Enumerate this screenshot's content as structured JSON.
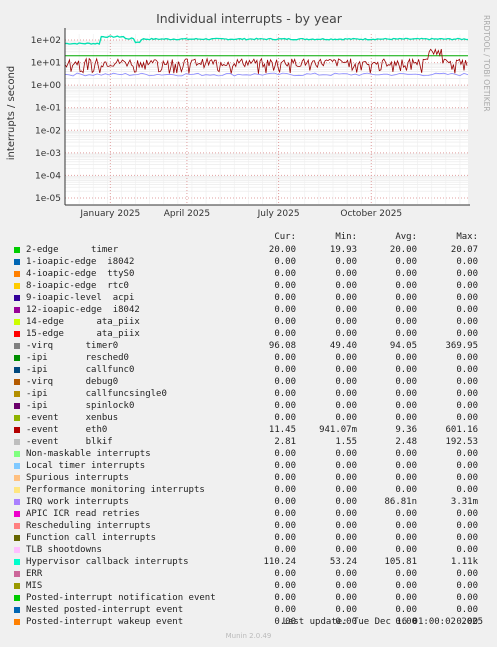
{
  "chart_data": {
    "type": "line",
    "title": "Individual interrupts - by year",
    "ylabel": "interrupts / second",
    "yscale": "log",
    "ylim": [
      1e-05,
      100
    ],
    "y_ticks": [
      "1e+02",
      "1e+01",
      "1e+00",
      "1e-01",
      "1e-02",
      "1e-03",
      "1e-04",
      "1e-05"
    ],
    "x_ticks": [
      "January 2025",
      "April 2025",
      "July 2025",
      "October 2025"
    ],
    "side_label": "RRDTOOL / TOBI OETIKER",
    "grid": true,
    "series_visible": [
      {
        "name": "Hypervisor callback interrupts",
        "color": "#00e0b0",
        "approx": "~70 until Dec 2024, ~110 after"
      },
      {
        "name": "-virq timer0",
        "color": "#990000",
        "approx": "noisy ~5-15 with spikes"
      },
      {
        "name": "2-edge timer",
        "color": "#00aa00",
        "approx": "constant ~20"
      },
      {
        "name": "-event eth0",
        "color": "#8888ff",
        "approx": "~3"
      }
    ]
  },
  "legend_headers": {
    "cur": "Cur:",
    "min": "Min:",
    "avg": "Avg:",
    "max": "Max:"
  },
  "legend": [
    {
      "label": "2-edge      timer",
      "color": "#00cc00",
      "cur": "20.00",
      "min": "19.93",
      "avg": "20.00",
      "max": "20.07"
    },
    {
      "label": "1-ioapic-edge  i8042",
      "color": "#0066b3",
      "cur": "0.00",
      "min": "0.00",
      "avg": "0.00",
      "max": "0.00"
    },
    {
      "label": "4-ioapic-edge  ttyS0",
      "color": "#ff8000",
      "cur": "0.00",
      "min": "0.00",
      "avg": "0.00",
      "max": "0.00"
    },
    {
      "label": "8-ioapic-edge  rtc0",
      "color": "#ffcc00",
      "cur": "0.00",
      "min": "0.00",
      "avg": "0.00",
      "max": "0.00"
    },
    {
      "label": "9-ioapic-level  acpi",
      "color": "#330099",
      "cur": "0.00",
      "min": "0.00",
      "avg": "0.00",
      "max": "0.00"
    },
    {
      "label": "12-ioapic-edge  i8042",
      "color": "#990099",
      "cur": "0.00",
      "min": "0.00",
      "avg": "0.00",
      "max": "0.00"
    },
    {
      "label": "14-edge      ata_piix",
      "color": "#ccff00",
      "cur": "0.00",
      "min": "0.00",
      "avg": "0.00",
      "max": "0.00"
    },
    {
      "label": "15-edge      ata_piix",
      "color": "#ff0000",
      "cur": "0.00",
      "min": "0.00",
      "avg": "0.00",
      "max": "0.00"
    },
    {
      "label": "-virq      timer0",
      "color": "#808080",
      "cur": "96.08",
      "min": "49.40",
      "avg": "94.05",
      "max": "369.95"
    },
    {
      "label": "-ipi       resched0",
      "color": "#008f00",
      "cur": "0.00",
      "min": "0.00",
      "avg": "0.00",
      "max": "0.00"
    },
    {
      "label": "-ipi       callfunc0",
      "color": "#00487d",
      "cur": "0.00",
      "min": "0.00",
      "avg": "0.00",
      "max": "0.00"
    },
    {
      "label": "-virq      debug0",
      "color": "#b35a00",
      "cur": "0.00",
      "min": "0.00",
      "avg": "0.00",
      "max": "0.00"
    },
    {
      "label": "-ipi       callfuncsingle0",
      "color": "#b38f00",
      "cur": "0.00",
      "min": "0.00",
      "avg": "0.00",
      "max": "0.00"
    },
    {
      "label": "-ipi       spinlock0",
      "color": "#6b006b",
      "cur": "0.00",
      "min": "0.00",
      "avg": "0.00",
      "max": "0.00"
    },
    {
      "label": "-event     xenbus",
      "color": "#8fb300",
      "cur": "0.00",
      "min": "0.00",
      "avg": "0.00",
      "max": "0.00"
    },
    {
      "label": "-event     eth0",
      "color": "#b30000",
      "cur": "11.45",
      "min": "941.07m",
      "avg": "9.36",
      "max": "601.16"
    },
    {
      "label": "-event     blkif",
      "color": "#bebebe",
      "cur": "2.81",
      "min": "1.55",
      "avg": "2.48",
      "max": "192.53"
    },
    {
      "label": "Non-maskable interrupts",
      "color": "#80ff80",
      "cur": "0.00",
      "min": "0.00",
      "avg": "0.00",
      "max": "0.00"
    },
    {
      "label": "Local timer interrupts",
      "color": "#80c9ff",
      "cur": "0.00",
      "min": "0.00",
      "avg": "0.00",
      "max": "0.00"
    },
    {
      "label": "Spurious interrupts",
      "color": "#ffc080",
      "cur": "0.00",
      "min": "0.00",
      "avg": "0.00",
      "max": "0.00"
    },
    {
      "label": "Performance monitoring interrupts",
      "color": "#ffe680",
      "cur": "0.00",
      "min": "0.00",
      "avg": "0.00",
      "max": "0.00"
    },
    {
      "label": "IRQ work interrupts",
      "color": "#aa80ff",
      "cur": "0.00",
      "min": "0.00",
      "avg": "86.81n",
      "max": "3.31m"
    },
    {
      "label": "APIC ICR read retries",
      "color": "#ee00cc",
      "cur": "0.00",
      "min": "0.00",
      "avg": "0.00",
      "max": "0.00"
    },
    {
      "label": "Rescheduling interrupts",
      "color": "#ff8080",
      "cur": "0.00",
      "min": "0.00",
      "avg": "0.00",
      "max": "0.00"
    },
    {
      "label": "Function call interrupts",
      "color": "#666600",
      "cur": "0.00",
      "min": "0.00",
      "avg": "0.00",
      "max": "0.00"
    },
    {
      "label": "TLB shootdowns",
      "color": "#ffbfff",
      "cur": "0.00",
      "min": "0.00",
      "avg": "0.00",
      "max": "0.00"
    },
    {
      "label": "Hypervisor callback interrupts",
      "color": "#00ffcc",
      "cur": "110.24",
      "min": "53.24",
      "avg": "105.81",
      "max": "1.11k"
    },
    {
      "label": "ERR",
      "color": "#cc6699",
      "cur": "0.00",
      "min": "0.00",
      "avg": "0.00",
      "max": "0.00"
    },
    {
      "label": "MIS",
      "color": "#999900",
      "cur": "0.00",
      "min": "0.00",
      "avg": "0.00",
      "max": "0.00"
    },
    {
      "label": "Posted-interrupt notification event",
      "color": "#00cc00",
      "cur": "0.00",
      "min": "0.00",
      "avg": "0.00",
      "max": "0.00"
    },
    {
      "label": "Nested posted-interrupt event",
      "color": "#0066b3",
      "cur": "0.00",
      "min": "0.00",
      "avg": "0.00",
      "max": "0.00"
    },
    {
      "label": "Posted-interrupt wakeup event",
      "color": "#ff8000",
      "cur": "0.00",
      "min": "0.00",
      "avg": "0.00",
      "max": "0.00"
    }
  ],
  "last_update": "Last update: Tue Dec 16 01:00:02 2025",
  "footer": "Munin 2.0.49"
}
